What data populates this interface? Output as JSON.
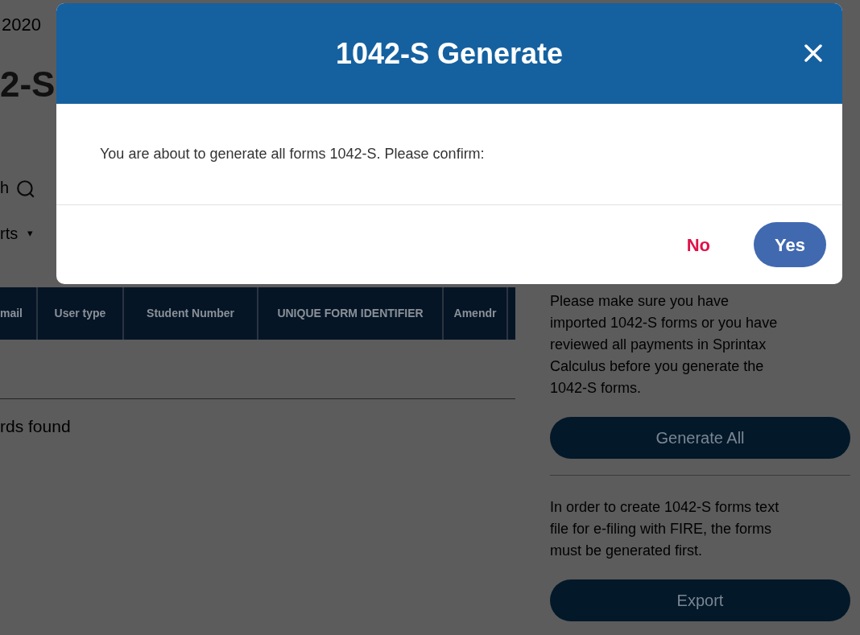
{
  "page": {
    "year": "2020",
    "heading": "2-S",
    "search_label": "h",
    "filter": {
      "label": "rts",
      "caret": "▾"
    },
    "table": {
      "columns": [
        "mail",
        "User type",
        "Student Number",
        "UNIQUE FORM IDENTIFIER",
        "Amendr"
      ]
    },
    "empty_message": "rds found"
  },
  "side_panel": {
    "generate_note": "Please make sure you have imported 1042-S forms or you have reviewed all payments in Sprintax Calculus before you generate the 1042-S forms.",
    "generate_button": "Generate All",
    "export_note": "In order to create 1042-S forms text file for e-filing with FIRE, the forms must be generated first.",
    "export_button": "Export"
  },
  "dialog": {
    "title": "1042-S Generate",
    "message": "You are about to generate all forms 1042-S. Please confirm:",
    "buttons": [
      {
        "label": "No",
        "kind": "text"
      },
      {
        "label": "Yes",
        "kind": "primary"
      }
    ]
  }
}
